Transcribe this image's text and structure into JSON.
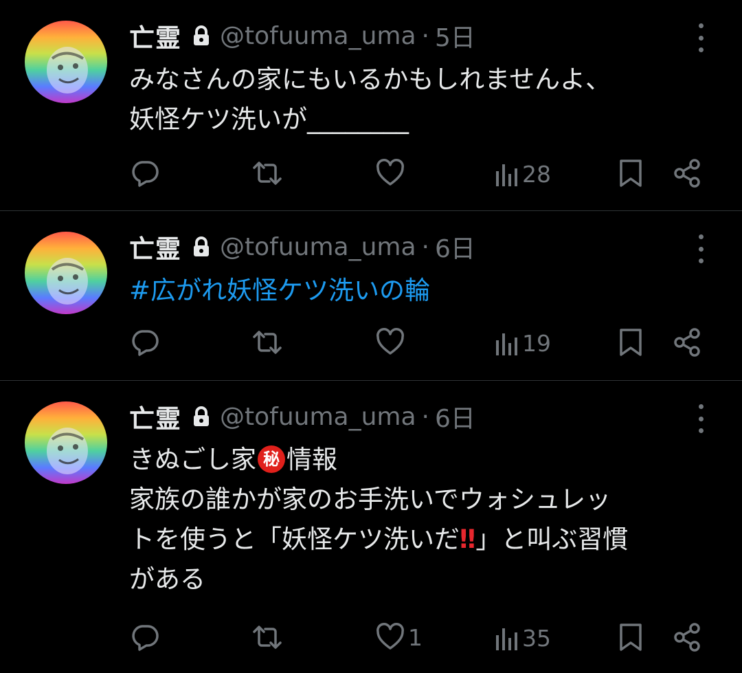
{
  "tweets": [
    {
      "name": "亡霊",
      "handle": "@tofuuma_uma",
      "separator": "·",
      "time": "5日",
      "lines": [
        "みなさんの家にもいるかもしれませんよ、",
        "妖怪ケツ洗いが________"
      ],
      "replies": "",
      "likes": "",
      "views": "28"
    },
    {
      "name": "亡霊",
      "handle": "@tofuuma_uma",
      "separator": "·",
      "time": "6日",
      "hashtag": "#広がれ妖怪ケツ洗いの輪",
      "likes": "",
      "views": "19"
    },
    {
      "name": "亡霊",
      "handle": "@tofuuma_uma",
      "separator": "·",
      "time": "6日",
      "line1_before": "きぬごし家",
      "secret_char": "秘",
      "line1_after": "情報",
      "line2": "家族の誰かが家のお手洗いでウォシュレッ",
      "line3_before": "トを使うと「妖怪ケツ洗いだ",
      "line3_bang": "‼",
      "line3_after": "」と叫ぶ習慣",
      "line4": "がある",
      "likes": "1",
      "views": "35"
    }
  ],
  "icons": [
    "lock-icon",
    "more-icon",
    "reply-icon",
    "retweet-icon",
    "like-icon",
    "views-icon",
    "bookmark-icon",
    "share-icon"
  ],
  "colors": {
    "background": "#000000",
    "text": "#e7e9ea",
    "muted": "#71767b",
    "link": "#1d9bf0",
    "divider": "#2f3336"
  }
}
